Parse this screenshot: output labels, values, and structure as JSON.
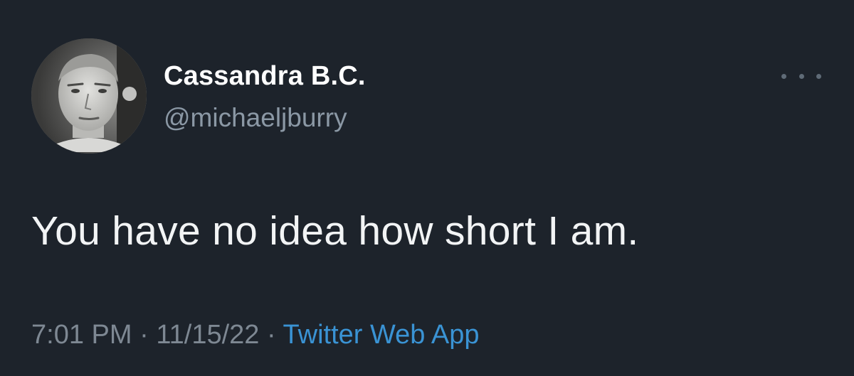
{
  "tweet": {
    "display_name": "Cassandra B.C.",
    "handle": "@michaeljburry",
    "text": "You have no idea how short I am.",
    "time": "7:01 PM",
    "separator": "·",
    "date": "11/15/22",
    "source": "Twitter Web App"
  },
  "icons": {
    "avatar": "profile-photo",
    "more": "more-dots-icon"
  },
  "colors": {
    "background": "#1d232b",
    "name": "#ffffff",
    "handle": "#8b98a5",
    "text": "#f2f4f5",
    "meta": "#7e8893",
    "link": "#3a93d4"
  }
}
